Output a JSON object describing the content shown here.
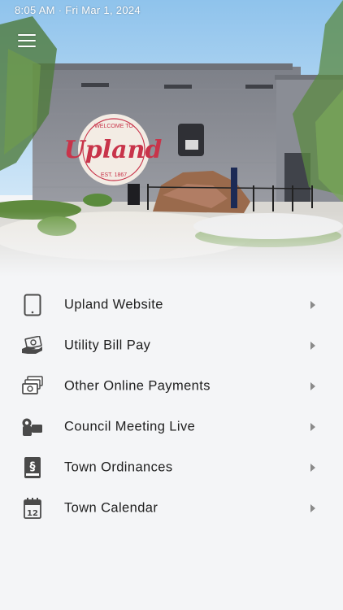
{
  "status": {
    "time": "8:05 AM",
    "date": "Fri Mar 1, 2024"
  },
  "hero": {
    "sign_top": "WELCOME TO",
    "sign_main": "Upland",
    "sign_bottom": "EST. 1867"
  },
  "menu": {
    "items": [
      {
        "label": "Upland Website",
        "icon": "tablet-icon"
      },
      {
        "label": "Utility Bill Pay",
        "icon": "hand-money-icon"
      },
      {
        "label": "Other Online Payments",
        "icon": "money-stack-icon"
      },
      {
        "label": "Council Meeting Live",
        "icon": "video-camera-icon"
      },
      {
        "label": "Town Ordinances",
        "icon": "section-book-icon"
      },
      {
        "label": "Town Calendar",
        "icon": "calendar-icon"
      }
    ]
  },
  "colors": {
    "icon": "#4a4a4a",
    "chevron": "#8a8a8a",
    "background": "#f4f5f7",
    "sign_red": "#c8344a"
  }
}
